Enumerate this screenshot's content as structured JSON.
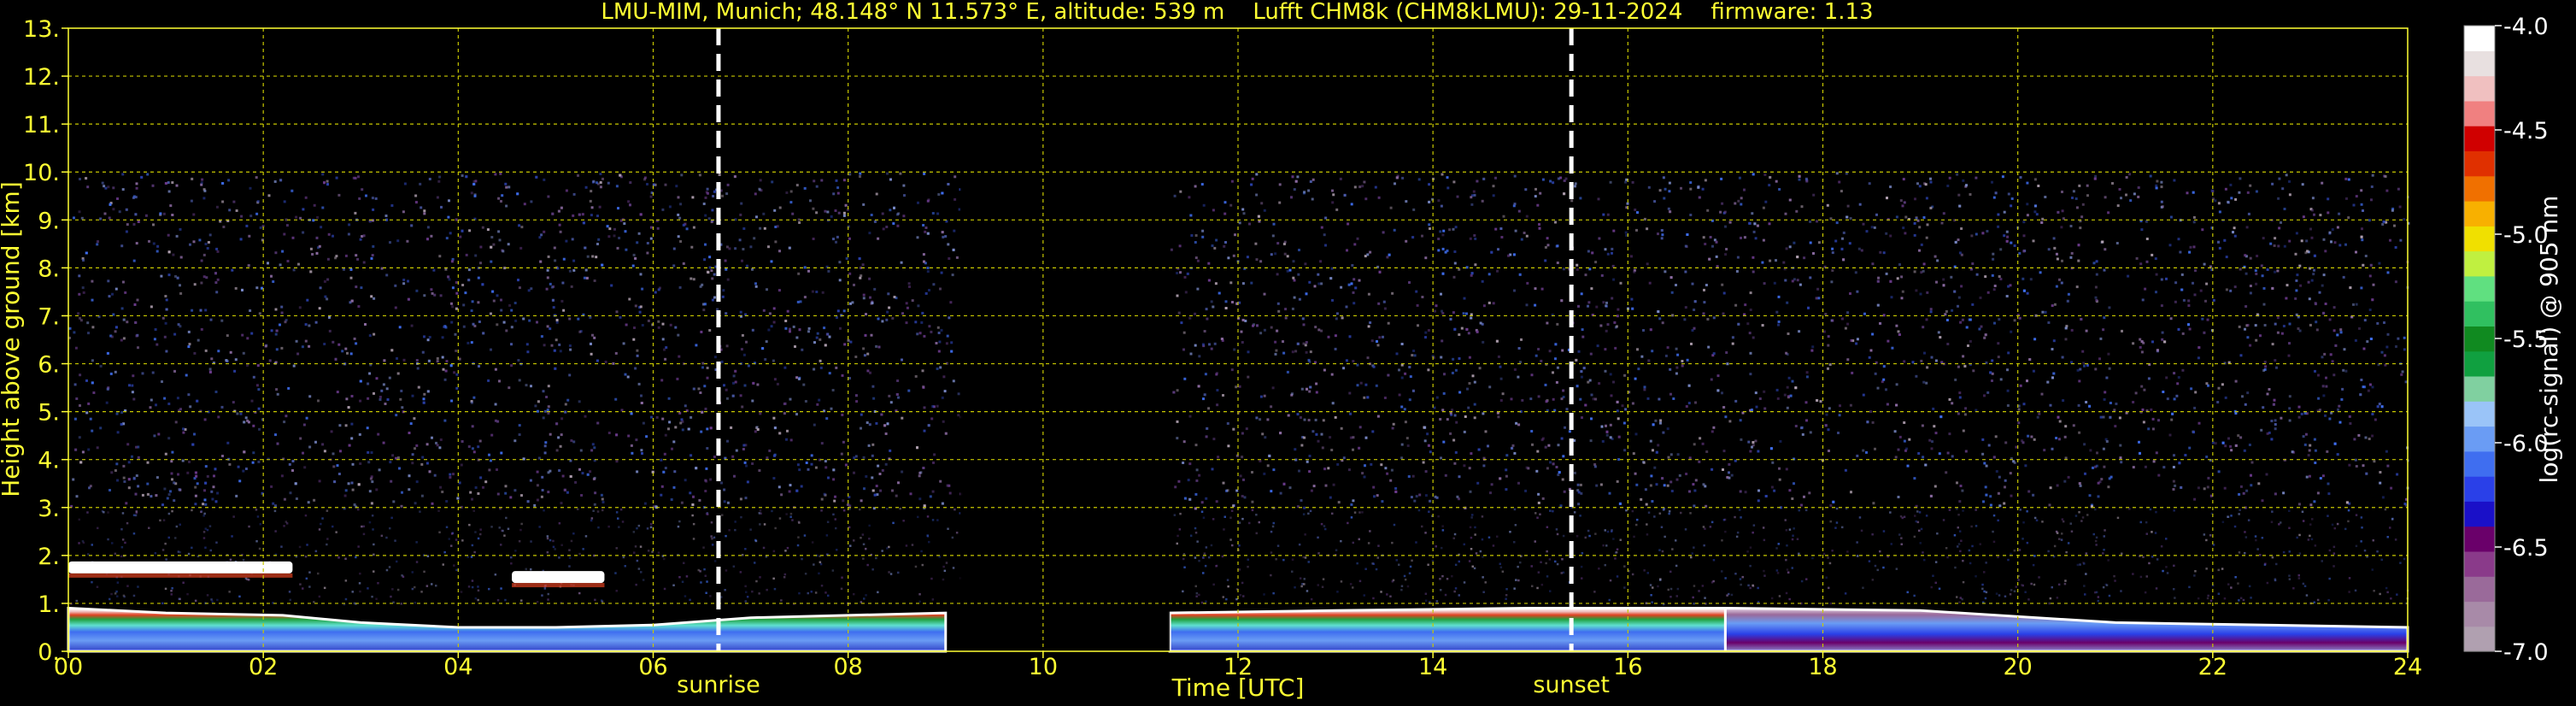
{
  "chart_data": {
    "type": "heatmap",
    "title": "LMU-MIM, Munich; 48.148° N 11.573° E, altitude: 539 m    Lufft CHM8k (CHM8kLMU): 29-11-2024    firmware: 1.13",
    "xlabel": "Time [UTC]",
    "ylabel": "Height above ground [km]",
    "colorbar_label": "log(rc-signal) @ 905 nm",
    "xlim": [
      0,
      24
    ],
    "ylim": [
      0,
      13
    ],
    "x_ticks": [
      "00",
      "02",
      "04",
      "06",
      "08",
      "10",
      "12",
      "14",
      "16",
      "18",
      "20",
      "22",
      "24"
    ],
    "y_ticks": [
      "0.",
      "1.",
      "2.",
      "3.",
      "4.",
      "5.",
      "6.",
      "7.",
      "8.",
      "9.",
      "10.",
      "11.",
      "12.",
      "13."
    ],
    "colorbar_range": [
      -7.0,
      -4.0
    ],
    "colorbar_ticks": [
      "-4.0",
      "-4.5",
      "-5.0",
      "-5.5",
      "-6.0",
      "-6.5",
      "-7.0"
    ],
    "colorbar_colors": [
      "#b0a0b0",
      "#a88aa8",
      "#9a6a9a",
      "#8a3a8a",
      "#6a006a",
      "#1a10c8",
      "#2a40e8",
      "#3f6ef0",
      "#6a9cf4",
      "#9ac4f8",
      "#80d0a0",
      "#10a040",
      "#108a20",
      "#30c060",
      "#60e080",
      "#c0f040",
      "#f0e000",
      "#f8b000",
      "#f07000",
      "#e03000",
      "#d00000",
      "#f08080",
      "#f0c0c0",
      "#e8e0e0",
      "#ffffff"
    ],
    "events": [
      {
        "label": "sunrise",
        "time": 6.67
      },
      {
        "label": "sunset",
        "time": 15.42
      }
    ],
    "grid": true,
    "data_gaps": [
      [
        9.15,
        11.3
      ]
    ],
    "noise_top_km": 10.0,
    "boundary_layer": [
      {
        "time": 0,
        "height": 0.9
      },
      {
        "time": 1,
        "height": 0.8
      },
      {
        "time": 2.2,
        "height": 0.75
      },
      {
        "time": 3,
        "height": 0.6
      },
      {
        "time": 4,
        "height": 0.5
      },
      {
        "time": 5,
        "height": 0.5
      },
      {
        "time": 6,
        "height": 0.55
      },
      {
        "time": 7,
        "height": 0.7
      },
      {
        "time": 8,
        "height": 0.75
      },
      {
        "time": 9,
        "height": 0.8
      },
      {
        "time": 11.3,
        "height": 0.8
      },
      {
        "time": 13,
        "height": 0.85
      },
      {
        "time": 15,
        "height": 0.9
      },
      {
        "time": 17,
        "height": 0.9
      },
      {
        "time": 19,
        "height": 0.85
      },
      {
        "time": 21,
        "height": 0.6
      },
      {
        "time": 24,
        "height": 0.5
      }
    ],
    "cloud_layers": [
      {
        "t0": 0,
        "t1": 2.3,
        "height": 1.75
      },
      {
        "t0": 4.55,
        "t1": 5.5,
        "height": 1.55
      }
    ]
  }
}
